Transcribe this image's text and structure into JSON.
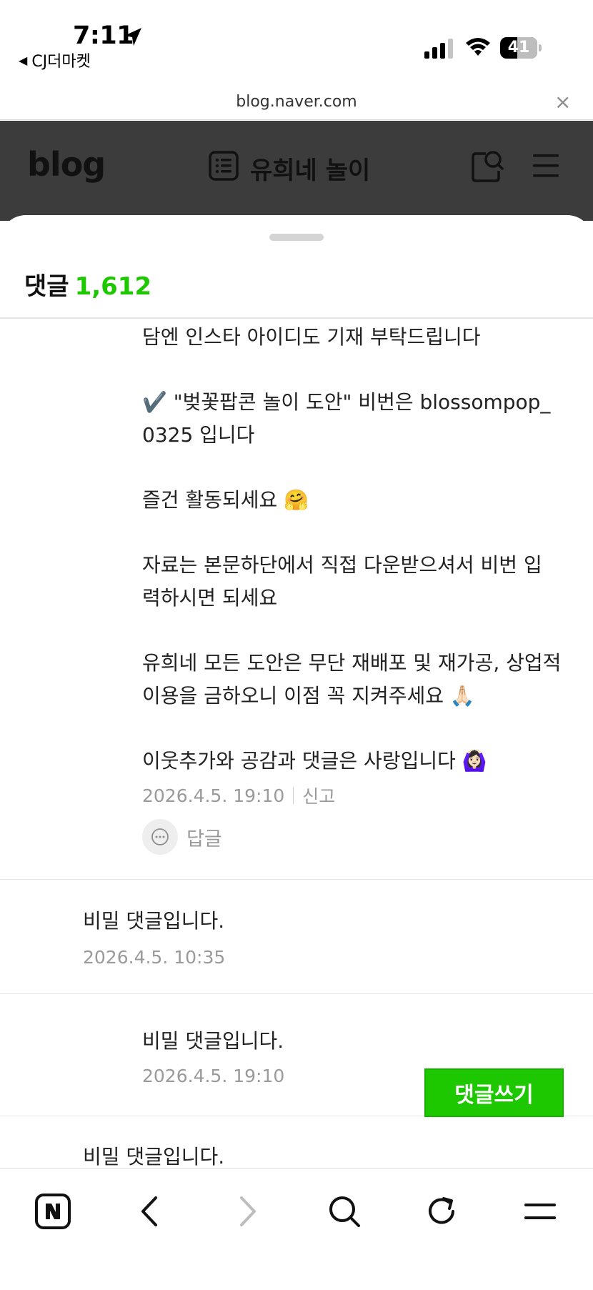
{
  "status_bar": {
    "time": "7:11",
    "back_app": "CJ더마켓",
    "back_arrow": "◀",
    "battery": "41"
  },
  "address_bar": {
    "url": "blog.naver.com",
    "close": "×"
  },
  "blog_header": {
    "logo": "blog",
    "title": "유희네 놀이"
  },
  "comments_sheet": {
    "title": "댓글",
    "count": "1,612",
    "reply_lines": [
      "담엔 인스타 아이디도 기재 부탁드립니다",
      "✔️ \"벚꽃팝콘 놀이 도안\" 비번은 blossompop_\n0325 입니다",
      "즐건 활동되세요 🤗",
      "자료는 본문하단에서 직접 다운받으셔서 비번 입\n력하시면 되세요",
      "유희네 모든 도안은 무단 재배포 및 재가공, 상업적\n이용을 금하오니 이점 꼭 지켜주세요 🙏🏻",
      "이웃추가와 공감과 댓글은 사랑입니다 🙆🏻‍♀️"
    ],
    "reply_date": "2026.4.5. 19:10",
    "report": "신고",
    "reply_button": "답글",
    "secret_comments": [
      {
        "text": "비밀 댓글입니다.",
        "date": "2026.4.5. 10:35"
      },
      {
        "text": "비밀 댓글입니다.",
        "date": "2026.4.5. 19:10"
      },
      {
        "text": "비밀 댓글입니다."
      }
    ],
    "write_button": "댓글쓰기"
  },
  "toolbar": {
    "icons": [
      "naver-n-icon",
      "back-icon",
      "forward-icon",
      "search-icon",
      "refresh-icon",
      "menu-icon"
    ]
  },
  "colors": {
    "accent_green": "#1ec800",
    "header_dim": "#3c3c3c"
  }
}
